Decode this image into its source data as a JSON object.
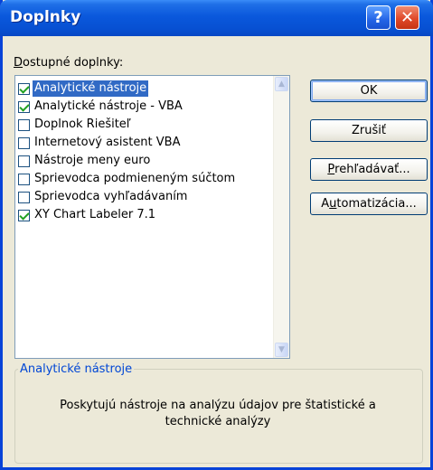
{
  "window": {
    "title": "Doplnky",
    "help_label": "?",
    "close_label": "✕"
  },
  "list": {
    "label_prefix": "D",
    "label_rest": "ostupné doplnky:",
    "items": [
      {
        "label": "Analytické nástroje",
        "checked": true,
        "selected": true
      },
      {
        "label": "Analytické nástroje - VBA",
        "checked": true,
        "selected": false
      },
      {
        "label": "Doplnok Riešiteľ",
        "checked": false,
        "selected": false
      },
      {
        "label": "Internetový asistent VBA",
        "checked": false,
        "selected": false
      },
      {
        "label": "Nástroje meny euro",
        "checked": false,
        "selected": false
      },
      {
        "label": "Sprievodca podmieneným súčtom",
        "checked": false,
        "selected": false
      },
      {
        "label": "Sprievodca vyhľadávaním",
        "checked": false,
        "selected": false
      },
      {
        "label": "XY Chart Labeler 7.1",
        "checked": true,
        "selected": false
      }
    ]
  },
  "buttons": {
    "ok": "OK",
    "cancel": "Zrušiť",
    "browse_prefix": "P",
    "browse_rest": "rehľadávať...",
    "automation_prefix": "A",
    "automation_mid": "u",
    "automation_rest": "tomatizácia..."
  },
  "details": {
    "title": "Analytické nástroje",
    "line1": "Poskytujú nástroje na analýzu údajov pre štatistické a",
    "line2": "technické analýzy"
  },
  "colors": {
    "selection": "#316ac5",
    "titlebar": "#0a58dc",
    "group_title": "#0046d5",
    "check": "#21a121"
  }
}
